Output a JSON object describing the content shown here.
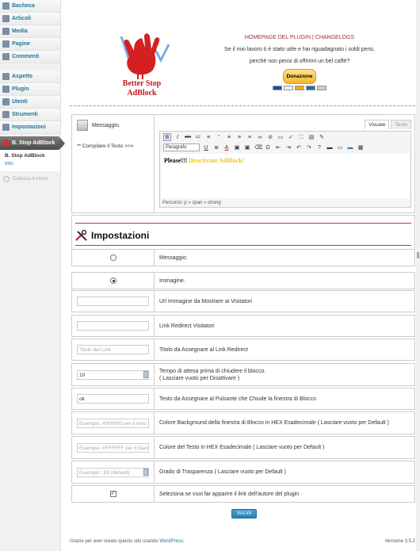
{
  "sidebar": {
    "items_top": [
      {
        "label": "Bacheca",
        "icon": "dashboard-icon"
      },
      {
        "label": "Articoli",
        "icon": "pin-icon"
      },
      {
        "label": "Media",
        "icon": "media-icon"
      },
      {
        "label": "Pagine",
        "icon": "pages-icon"
      },
      {
        "label": "Commenti",
        "icon": "comments-icon"
      }
    ],
    "items_bottom": [
      {
        "label": "Aspetto",
        "icon": "appearance-icon"
      },
      {
        "label": "Plugin",
        "icon": "plugin-icon"
      },
      {
        "label": "Utenti",
        "icon": "users-icon"
      },
      {
        "label": "Strumenti",
        "icon": "tools-icon"
      },
      {
        "label": "Impostazioni",
        "icon": "settings-icon"
      }
    ],
    "active": {
      "label": "B. Stop AdBlock",
      "icon": "bstop-icon"
    },
    "submenu": [
      "B. Stop AdBlock",
      "Info"
    ],
    "collapse": "Collassa il menu"
  },
  "header": {
    "logo_line1": "Better Stop",
    "logo_line2": "AdBlock",
    "links": "HOMEPAGE DEL PLUGIN | CHANGELOGS",
    "line1": "Se il mio lavoro ti è stato utile e hai riguadagnato i soldi persi,",
    "line2": "perchè non pensi di offrirmi un bel caffè?",
    "donate": "Donazione"
  },
  "editor": {
    "label": "Messaggio.",
    "hint": "** Compilare il Testo >>>",
    "tab_visual": "Visuale",
    "tab_text": "Testo",
    "format": "Paragrafo",
    "content_bold": "Please!!!",
    "content_yellow": "Deactivate AdBlock!",
    "path": "Percorso: p » span » strong"
  },
  "settings": {
    "title": "Impostazioni",
    "rows": [
      {
        "control": "radio",
        "checked": false,
        "label": "Messaggio."
      },
      {
        "control": "radio",
        "checked": true,
        "label": "Immagine."
      },
      {
        "control": "input",
        "value": "",
        "placeholder": "",
        "label": "Url Immagine da Mostrare ai Visitatori"
      },
      {
        "control": "input",
        "value": "",
        "placeholder": "",
        "label": "Link Redirect Visitatori"
      },
      {
        "control": "input",
        "value": "",
        "placeholder": "Titolo del Link",
        "label": "Titolo da Assegnare al Link Redirect"
      },
      {
        "control": "spin",
        "value": "10",
        "placeholder": "",
        "label": "Tempo di attesa prima di chiudere il blocco.",
        "label2": "( Lasciare vuoto per Disattivare )"
      },
      {
        "control": "input",
        "value": "ok",
        "placeholder": "",
        "label": "Testo da Assegnare al Pulsante che Chiude la finestra di Blocco"
      },
      {
        "control": "input",
        "value": "",
        "placeholder": "Esempio: #000000 per il nero",
        "label": "Colore Background della finestra di Blocco in HEX Esadecimale ( Lasciare vuoto per Default )"
      },
      {
        "control": "input",
        "value": "",
        "placeholder": "Esempio: #FFFFFF per il bianco",
        "label": "Colore del Testo in HEX Esadecimale ( Lasciare vuoto per Default )"
      },
      {
        "control": "spin",
        "value": "",
        "placeholder": "Esempio: .95 (default)",
        "label": "Grado di Trasparenza ( Lasciare vuoto per Default )"
      },
      {
        "control": "checkbox",
        "checked": true,
        "label": "Seleziona se vuoi far apparire il link dell'autore del plugin"
      }
    ]
  },
  "save_label": "SALVA",
  "footer": {
    "thanks": "Grazie per aver creato questo sito usando",
    "wp": "WordPress",
    "dot": ".",
    "version": "Versione 3.5.2"
  }
}
